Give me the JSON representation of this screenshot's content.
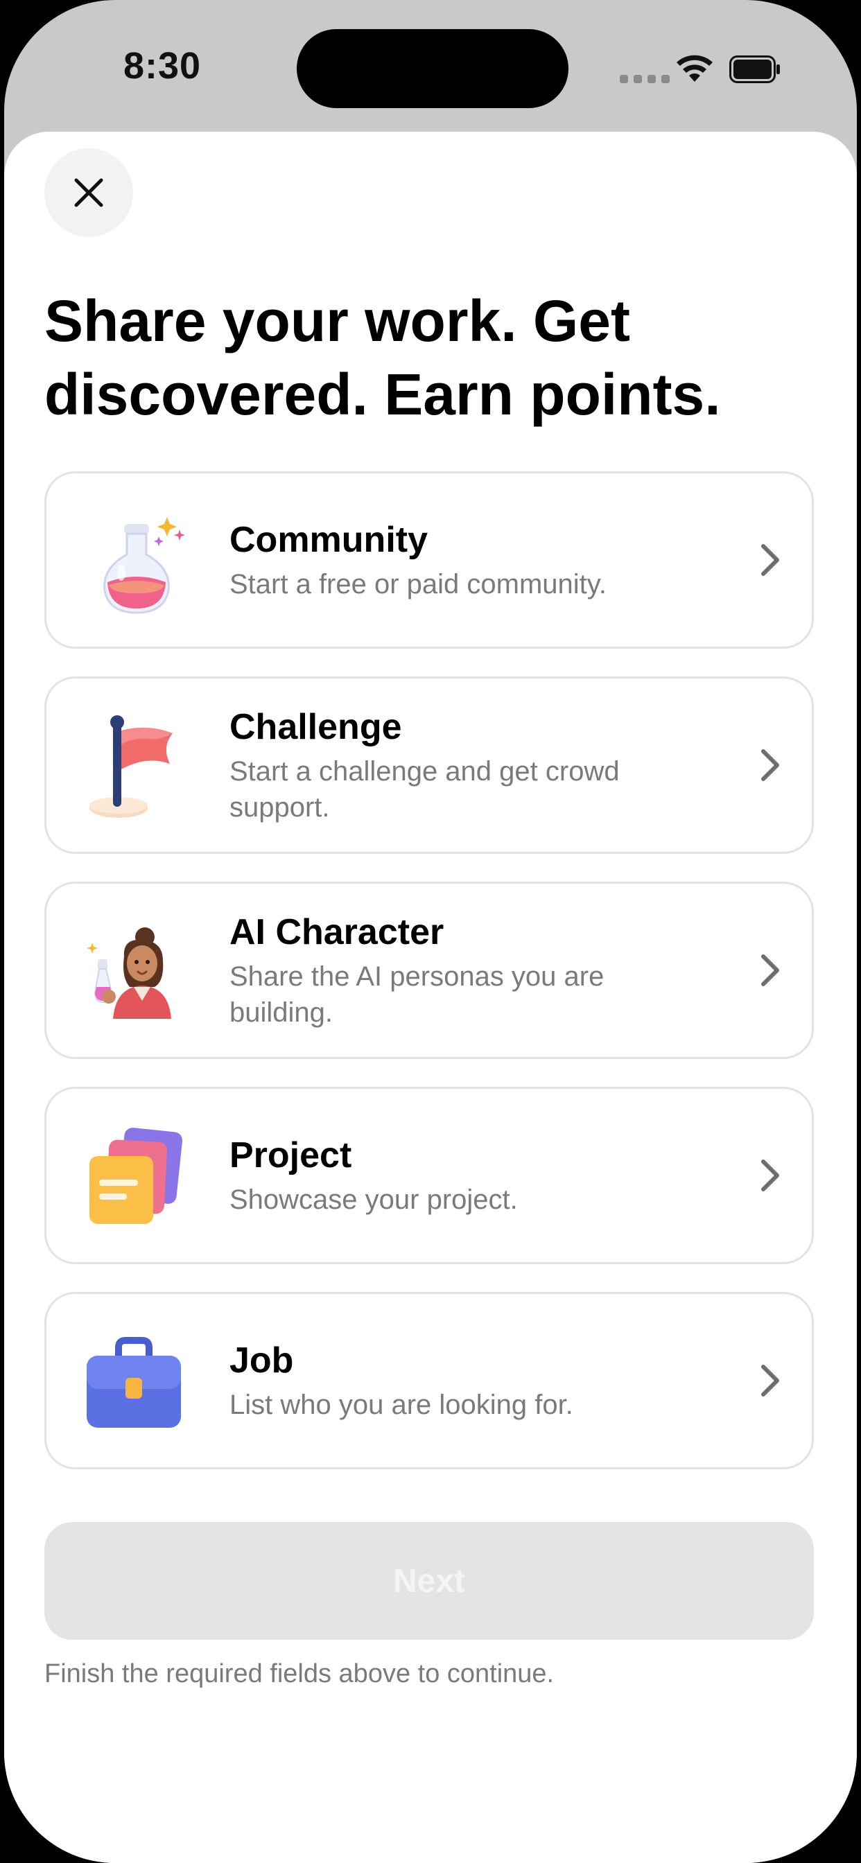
{
  "status_bar": {
    "time": "8:30"
  },
  "sheet": {
    "close_icon": "close-icon",
    "title": "Share your work. Get discovered. Earn points.",
    "options": [
      {
        "title": "Community",
        "subtitle": "Start a free or paid community.",
        "icon": "potion-flask-icon"
      },
      {
        "title": "Challenge",
        "subtitle": "Start a challenge and get crowd support.",
        "icon": "red-flag-icon"
      },
      {
        "title": "AI Character",
        "subtitle": "Share the AI personas you are building.",
        "icon": "ai-character-avatar-icon"
      },
      {
        "title": "Project",
        "subtitle": "Showcase your project.",
        "icon": "stacked-documents-icon"
      },
      {
        "title": "Job",
        "subtitle": "List who you are looking for.",
        "icon": "briefcase-icon"
      }
    ],
    "next_label": "Next",
    "hint": "Finish the required fields above to continue."
  },
  "colors": {
    "card_border": "#e3e3e3",
    "disabled_button": "#e4e4e4",
    "secondary_text": "#7a7a7a"
  }
}
